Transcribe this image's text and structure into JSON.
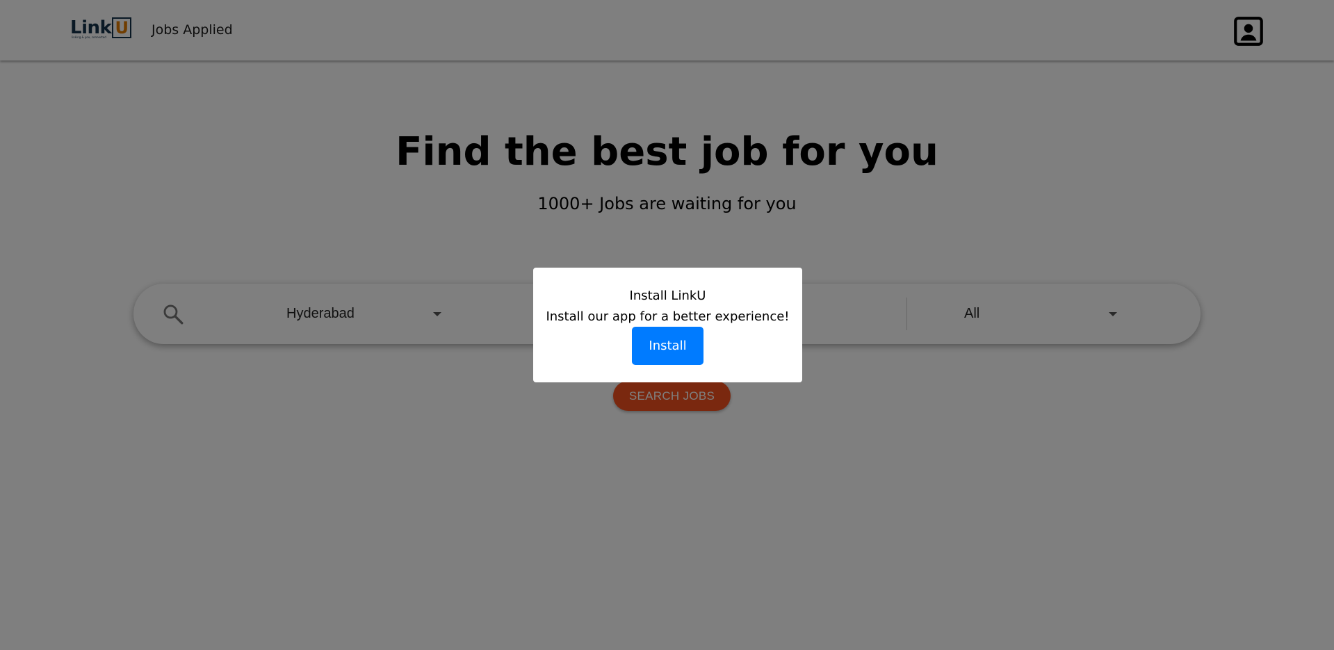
{
  "app": {
    "logo_text": "Link",
    "logo_letter": "U",
    "logo_tagline": "linking & you, connected",
    "brand_colors": {
      "navy": "#15324a",
      "orange": "#e07b00"
    }
  },
  "nav": {
    "jobs_applied": "Jobs Applied",
    "profile_icon": "account-box-icon"
  },
  "hero": {
    "title": "Find the best job for you",
    "subtitle": "1000+ Jobs are waiting for you"
  },
  "search": {
    "icon": "search-icon",
    "location_value": "Hyderabad",
    "type_value": "All",
    "button_label": "SEARCH JOBS",
    "button_color": "#f4511e"
  },
  "modal": {
    "title": "Install LinkU",
    "message": "Install our app for a better experience!",
    "install_label": "Install",
    "install_color": "#007bff",
    "overlay_opacity": 0.5
  }
}
